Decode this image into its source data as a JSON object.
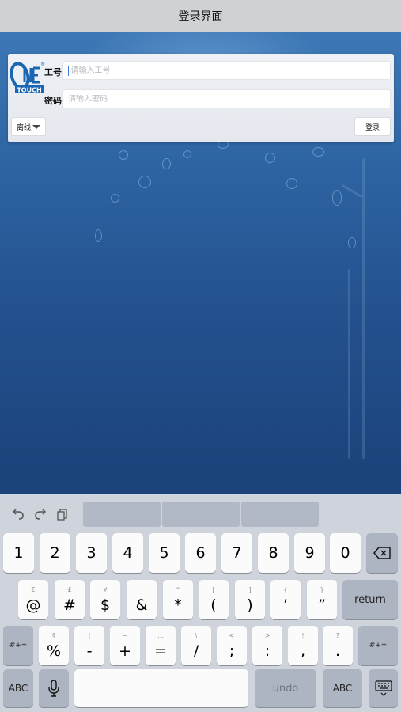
{
  "nav": {
    "title": "登录界面"
  },
  "logo": {
    "text_top": "One",
    "text_bottom": "TOUCH",
    "reg": "®"
  },
  "form": {
    "employee_id_label": "工号",
    "employee_id_placeholder": "请输入工号",
    "employee_id_value": "",
    "password_label": "密码",
    "password_placeholder": "请输入密码",
    "password_value": "",
    "mode_label": "离线",
    "login_label": "登录"
  },
  "keyboard": {
    "toolbar_icons": [
      "undo-icon",
      "redo-icon",
      "paste-icon"
    ],
    "row1": [
      {
        "main": "1"
      },
      {
        "main": "2"
      },
      {
        "main": "3"
      },
      {
        "main": "4"
      },
      {
        "main": "5"
      },
      {
        "main": "6"
      },
      {
        "main": "7"
      },
      {
        "main": "8"
      },
      {
        "main": "9"
      },
      {
        "main": "0"
      }
    ],
    "row2": [
      {
        "alt": "€",
        "main": "@"
      },
      {
        "alt": "£",
        "main": "#"
      },
      {
        "alt": "¥",
        "main": "$"
      },
      {
        "alt": "_",
        "main": "&"
      },
      {
        "alt": "^",
        "main": "*"
      },
      {
        "alt": "[",
        "main": "("
      },
      {
        "alt": "]",
        "main": ")"
      },
      {
        "alt": "{",
        "main": "’"
      },
      {
        "alt": "}",
        "main": "”"
      }
    ],
    "row3": [
      {
        "alt": "§",
        "main": "%"
      },
      {
        "alt": "|",
        "main": "-"
      },
      {
        "alt": "~",
        "main": "+"
      },
      {
        "alt": "…",
        "main": "="
      },
      {
        "alt": "\\",
        "main": "/"
      },
      {
        "alt": "<",
        "main": ";"
      },
      {
        "alt": ">",
        "main": ":"
      },
      {
        "alt": "!",
        "main": ","
      },
      {
        "alt": "?",
        "main": "."
      }
    ],
    "return_label": "return",
    "shift_symbols_label": "#+=",
    "abc_label": "ABC",
    "undo_label": "undo"
  },
  "colors": {
    "accent": "#3b7bdc",
    "keyboard_bg": "#cfd3db",
    "key_dark": "#adb4c2",
    "nav_bg": "#cfd1d4"
  }
}
